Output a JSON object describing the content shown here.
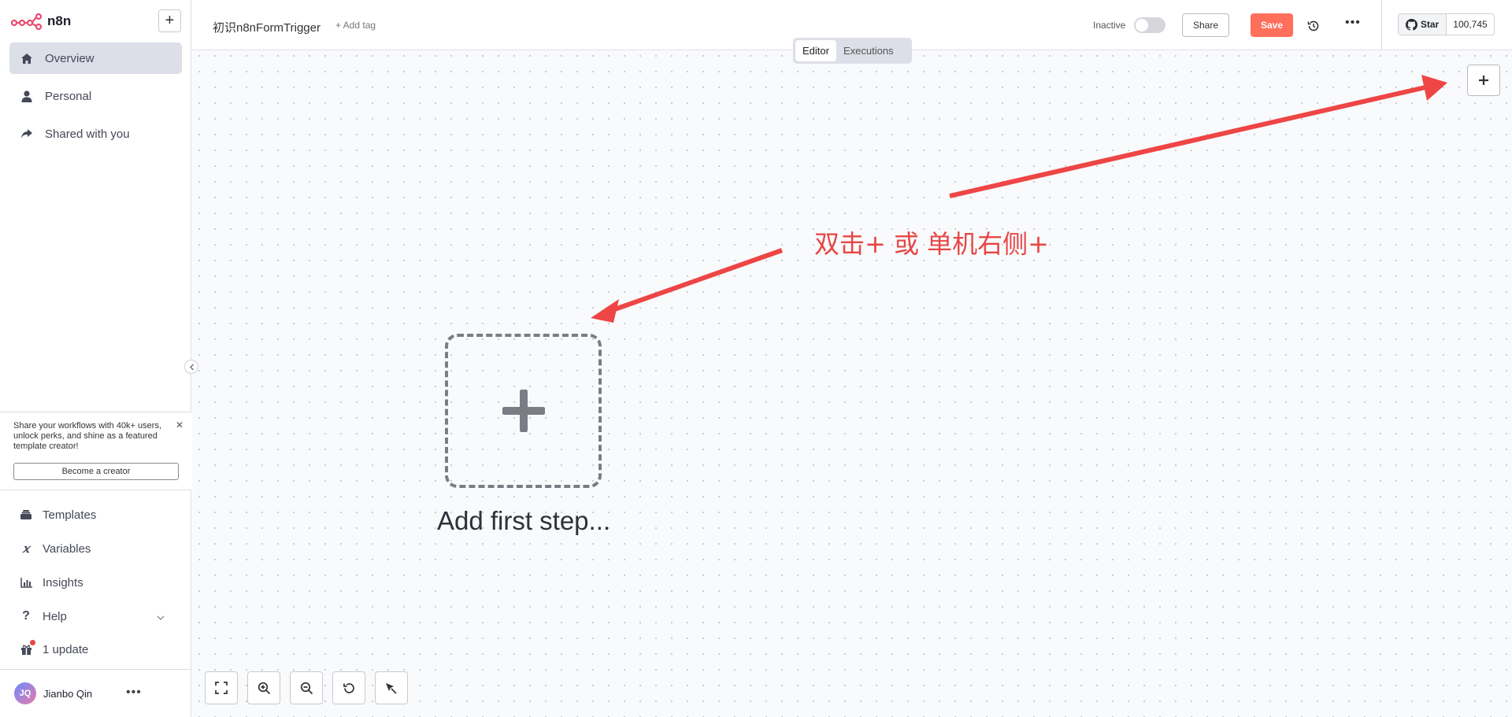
{
  "app": {
    "logo_text": "n8n"
  },
  "sidebar": {
    "items": [
      {
        "label": "Overview",
        "icon": "home-icon",
        "active": true
      },
      {
        "label": "Personal",
        "icon": "user-icon"
      },
      {
        "label": "Shared with you",
        "icon": "share-icon"
      }
    ],
    "promo": {
      "text": "Share your workflows with 40k+ users, unlock perks, and shine as a featured template creator!",
      "button": "Become a creator"
    },
    "bottom_items": [
      {
        "label": "Templates",
        "icon": "templates-icon"
      },
      {
        "label": "Variables",
        "icon": "variables-icon"
      },
      {
        "label": "Insights",
        "icon": "insights-icon"
      },
      {
        "label": "Help",
        "icon": "help-icon"
      },
      {
        "label": "1 update",
        "icon": "gift-icon"
      }
    ],
    "user": {
      "initials": "JQ",
      "name": "Jianbo Qin"
    }
  },
  "header": {
    "workflow_title": "初识n8nFormTrigger",
    "add_tag": "+ Add tag",
    "status_label": "Inactive",
    "share_label": "Share",
    "save_label": "Save",
    "github": {
      "star_label": "Star",
      "count": "100,745"
    }
  },
  "tabs": [
    {
      "label": "Editor",
      "active": true
    },
    {
      "label": "Executions"
    }
  ],
  "canvas": {
    "first_step_label": "Add first step...",
    "annotation": "双击+ 或 单机右侧+"
  },
  "colors": {
    "accent": "#ff6f5c",
    "annotation": "#e84545",
    "logo": "#ea4b71"
  }
}
